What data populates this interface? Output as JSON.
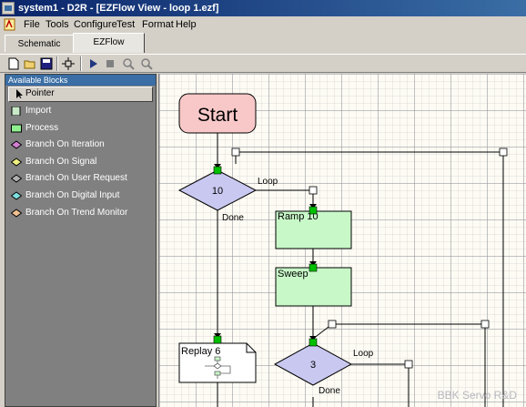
{
  "window": {
    "title": "system1 - D2R - [EZFlow View - loop 1.ezf]"
  },
  "menu": {
    "items": [
      "File",
      "Tools",
      "Configure",
      "Test",
      "Format",
      "Help"
    ]
  },
  "tabs": [
    {
      "label": "Schematic",
      "active": false
    },
    {
      "label": "EZFlow",
      "active": true
    }
  ],
  "toolbar": {
    "buttons": [
      "new-icon",
      "open-icon",
      "save-icon",
      "layout-icon",
      "run-icon",
      "stop-icon",
      "zoom-in-icon",
      "zoom-out-icon"
    ]
  },
  "palette": {
    "header": "Available Blocks",
    "items": [
      {
        "label": "Pointer",
        "icon": "pointer-icon",
        "selected": true
      },
      {
        "label": "Import",
        "icon": "import-icon",
        "color": "#c8e8c8"
      },
      {
        "label": "Process",
        "icon": "process-icon",
        "color": "#90f090"
      },
      {
        "label": "Branch On Iteration",
        "icon": "iteration-diamond-icon",
        "color": "#d080d0"
      },
      {
        "label": "Branch On Signal",
        "icon": "signal-diamond-icon",
        "color": "#f0f080"
      },
      {
        "label": "Branch On User Request",
        "icon": "user-request-diamond-icon",
        "color": "#b0b0b0"
      },
      {
        "label": "Branch On Digital Input",
        "icon": "digital-input-diamond-icon",
        "color": "#80e0e0"
      },
      {
        "label": "Branch On Trend Monitor",
        "icon": "trend-monitor-diamond-icon",
        "color": "#f0c090"
      }
    ]
  },
  "flow": {
    "start": "Start",
    "loop1": {
      "count": "10",
      "loop_label": "Loop",
      "done_label": "Done"
    },
    "ramp": "Ramp 10",
    "sweep": "Sweep",
    "replay": "Replay 6",
    "loop2": {
      "count": "3",
      "loop_label": "Loop",
      "done_label": "Done"
    }
  },
  "colors": {
    "start_fill": "#f8c8c8",
    "process_fill": "#c8f8c8",
    "decision_fill": "#c8c8f0",
    "port": "#00c000"
  },
  "watermark": "BBK Servo R&D"
}
